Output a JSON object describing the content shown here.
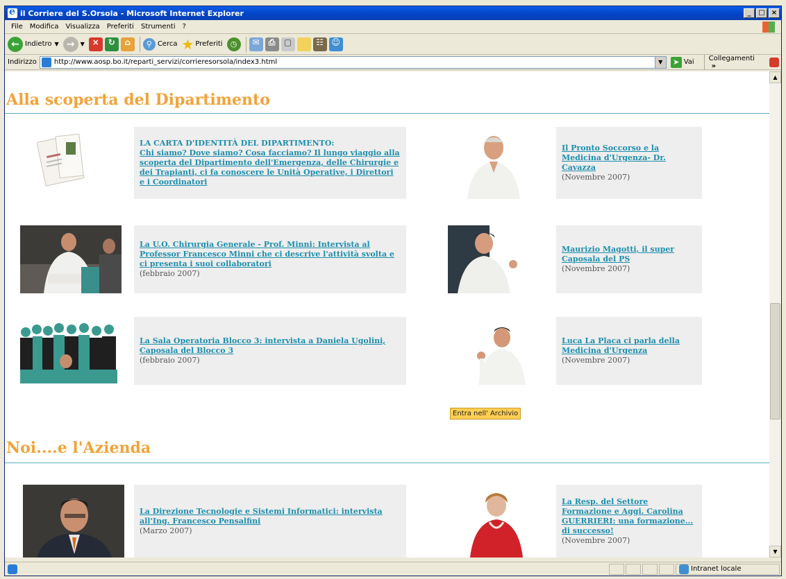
{
  "window": {
    "title": "il Corriere del S.Orsola - Microsoft Internet Explorer",
    "controls": [
      "_",
      "×"
    ]
  },
  "menu": [
    "File",
    "Modifica",
    "Visualizza",
    "Preferiti",
    "Strumenti",
    "?"
  ],
  "toolbar": {
    "back": "Indietro",
    "search": "Cerca",
    "favorites": "Preferiti"
  },
  "address": {
    "label": "Indirizzo",
    "url": "http://www.aosp.bo.it/reparti_servizi/corrieresorsola/index3.html",
    "go": "Vai",
    "links": "Collegamenti"
  },
  "sections": [
    {
      "title": "Alla scoperta del Dipartimento",
      "items": [
        {
          "head": "LA CARTA D'IDENTITÀ DEL DIPARTIMENTO:",
          "link": "Chi siamo? Dove siamo? Cosa facciamo? Il lungo viaggio alla scoperta del Dipartimento dell'Emergenza, delle Chirurgie e dei Trapianti, ci fa conoscere le Unità Operative, i Direttori e i Coordinatori",
          "date": ""
        },
        {
          "head": "",
          "link": "Il Pronto Soccorso e la Medicina d'Urgenza- Dr. Cavazza",
          "date": "(Novembre 2007)"
        },
        {
          "head": "",
          "link": "La U.O. Chirurgia Generale - Prof. Minni: Intervista al Professor Francesco Minni che ci descrive l'attività svolta e ci presenta i suoi collaboratori",
          "date": "(febbraio 2007)"
        },
        {
          "head": "",
          "link": "Maurizio Magotti, il super Caposala del PS",
          "date": "(Novembre 2007)"
        },
        {
          "head": "",
          "link": "La Sala Operatoria Blocco 3: intervista a Daniela Ugolini, Caposala del Blocco 3",
          "date": "(febbraio 2007)"
        },
        {
          "head": "",
          "link": "Luca La Placa ci parla della Medicina d'Urgenza",
          "date": "(Novembre 2007)"
        }
      ],
      "archive_button": "Entra nell' Archivio"
    },
    {
      "title": "Noi....e l'Azienda",
      "items": [
        {
          "head": "",
          "link": "La Direzione  Tecnologie e Sistemi Informatici: intervista all'Ing. Francesco Pensalfini",
          "date": "(Marzo 2007)"
        },
        {
          "head": "",
          "link": "La Resp. del Settore Formazione e Aggi. Carolina GUERRIERI: una formazione... di successo!",
          "date": "(Novembre 2007)"
        }
      ]
    }
  ],
  "status": {
    "zone": "Intranet locale"
  },
  "colors": {
    "section_title": "#f2a33a",
    "link": "#1d8eae",
    "card_bg": "#eeeeee",
    "rule": "#5aa9bf"
  }
}
